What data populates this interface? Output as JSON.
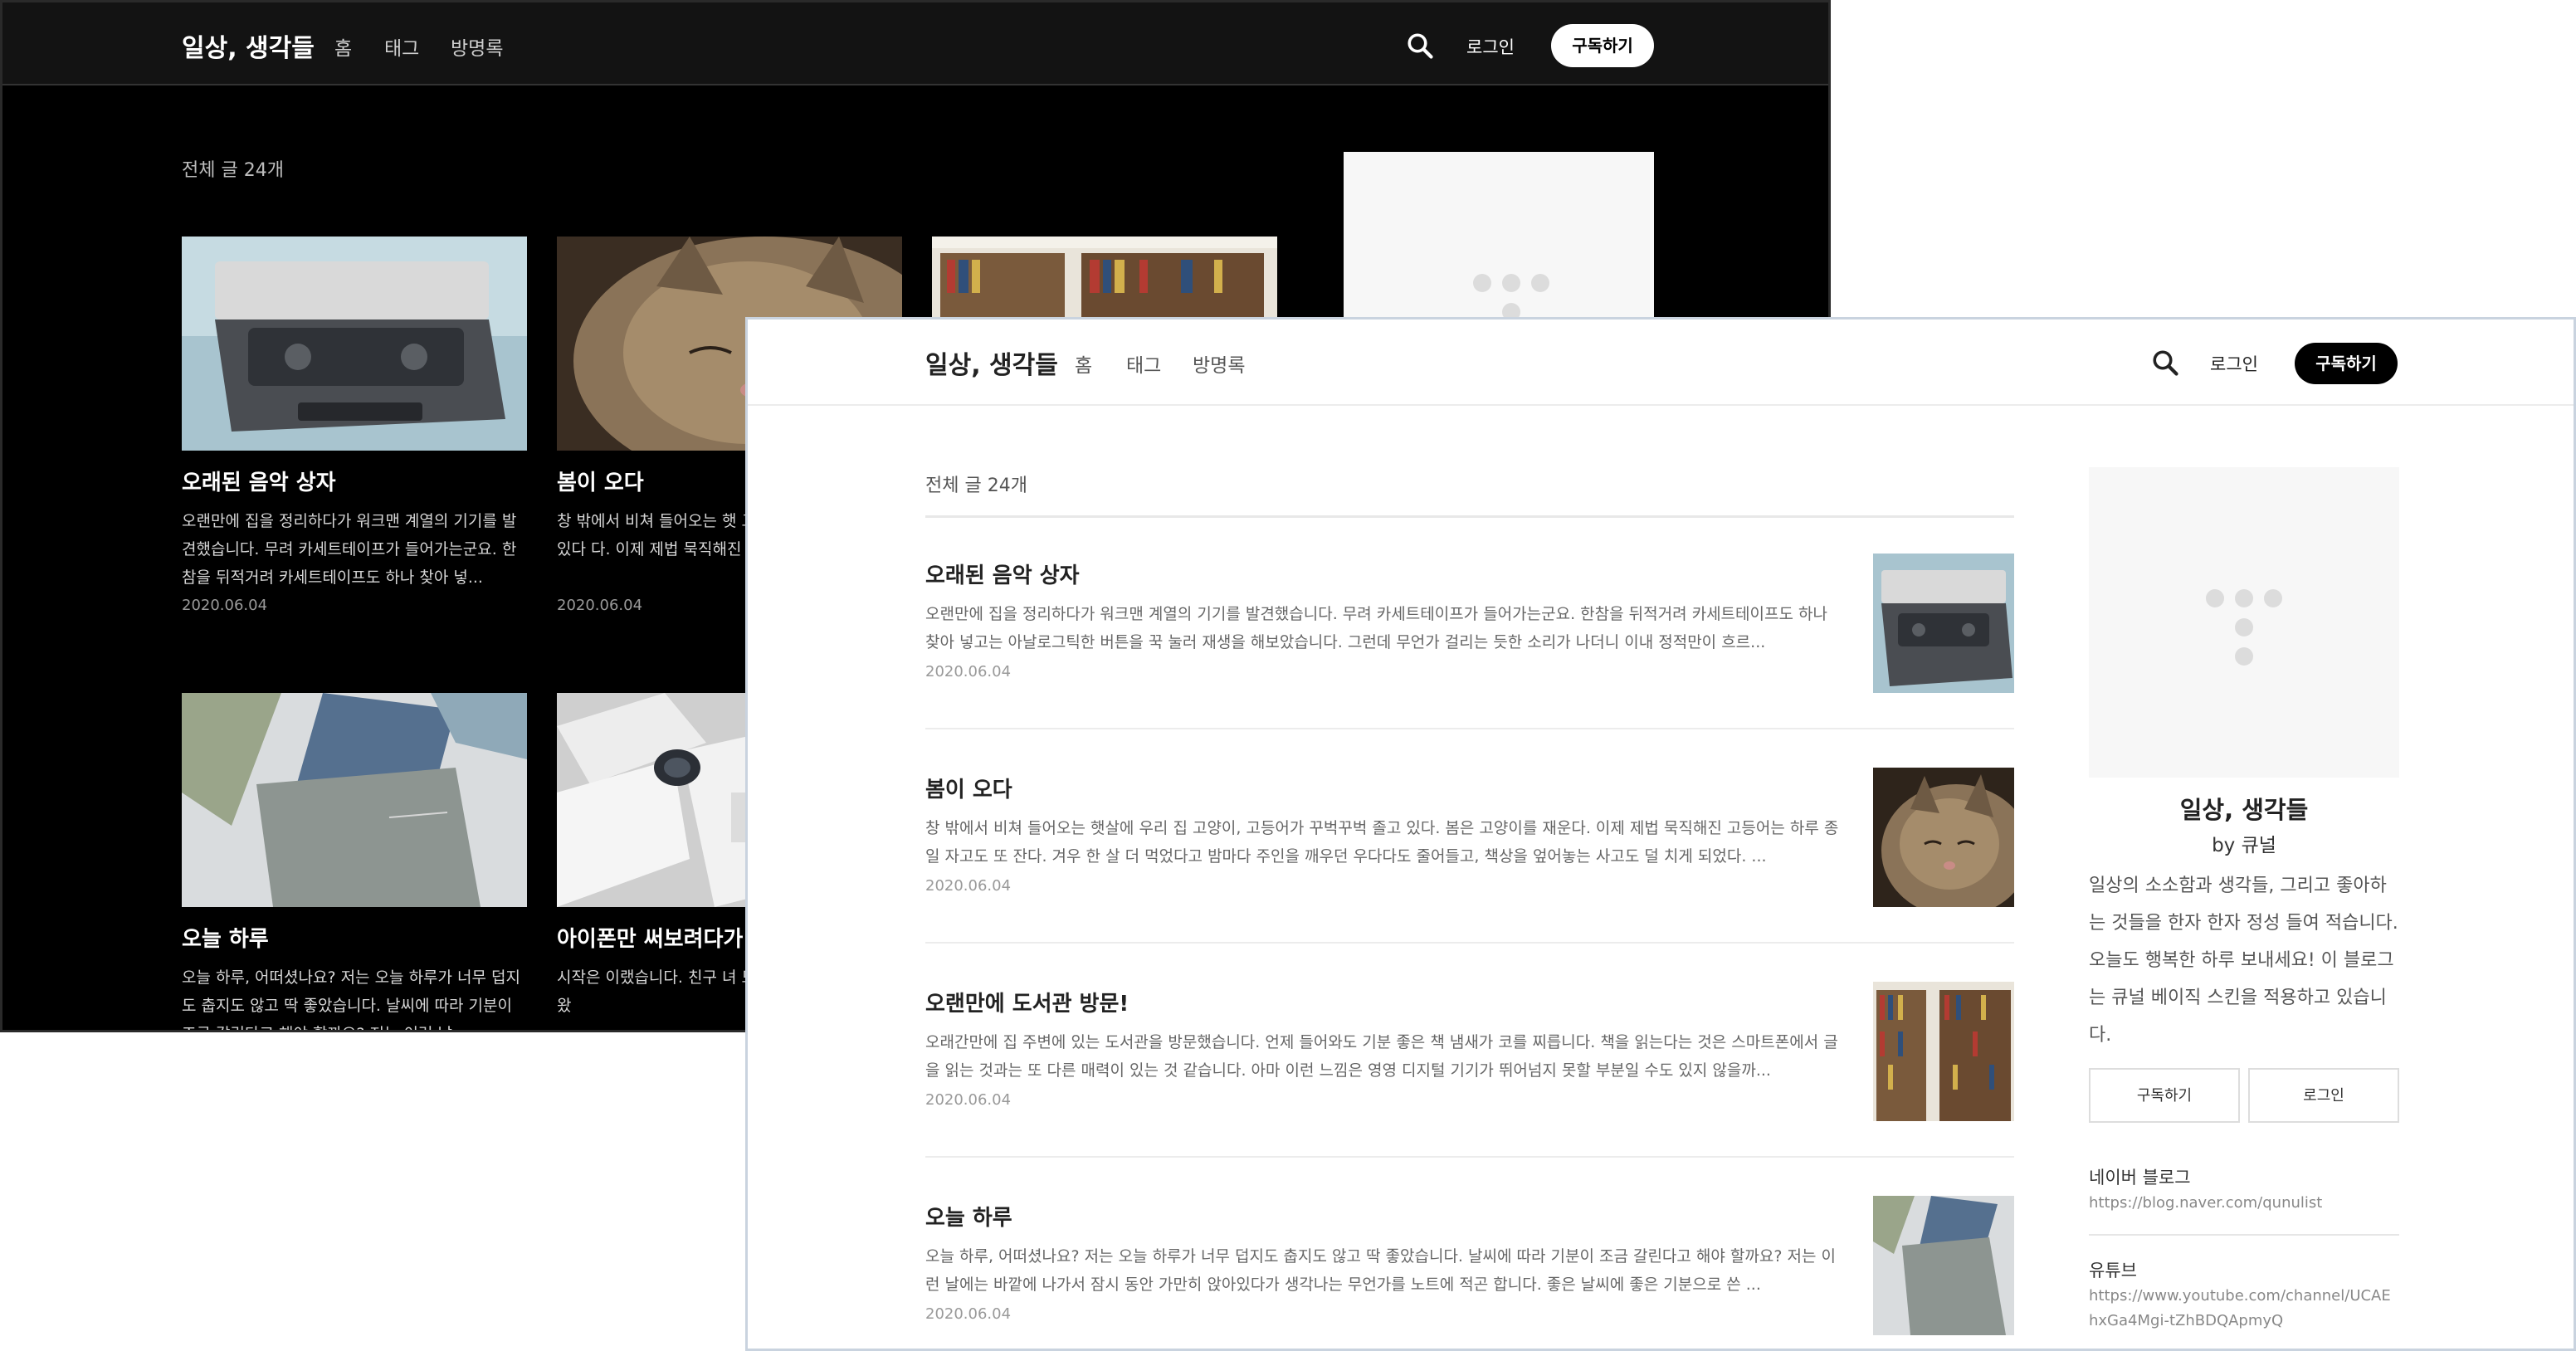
{
  "blog": {
    "title": "일상, 생각들",
    "nav": [
      "홈",
      "태그",
      "방명록"
    ],
    "login_label": "로그인",
    "subscribe_label": "구독하기",
    "post_count_label": "전체 글 24개"
  },
  "dark_view": {
    "cards": [
      {
        "title": "오래된 음악 상자",
        "excerpt": "오랜만에 집을 정리하다가 워크맨 계열의 기기를 발견했습니다. 무려 카세트테이프가 들어가는군요. 한참을 뒤적거려 카세트테이프도 하나 찾아 넣...",
        "date": "2020.06.04",
        "image": "cassette-player"
      },
      {
        "title": "봄이 오다",
        "excerpt": "창 밖에서 비쳐 들어오는 햇 고등어가 꾸벅꾸벅 졸고 있다 다. 이제 제법 묵직해진 고등",
        "date": "2020.06.04",
        "image": "sleeping-cat"
      },
      {
        "title": "오랜만에 도서관 방문!",
        "excerpt": "",
        "date": "",
        "image": "library-shelves"
      },
      {
        "title": "오늘 하루",
        "excerpt": "오늘 하루, 어떠셨나요? 저는 오늘 하루가 너무 덥지도 춥지도 않고 딱 좋았습니다. 날씨에 따라 기분이 조금 갈린다고 해야 할까요? 저는 이런 날...",
        "date": "",
        "image": "notebooks"
      },
      {
        "title": "아이폰만 써보려다가 된 썰",
        "excerpt": "시작은 이랬습니다. 친구 녀 모한 호대폰 하나를 가져왔",
        "date": "",
        "image": "watch-box"
      }
    ]
  },
  "light_view": {
    "posts": [
      {
        "title": "오래된 음악 상자",
        "excerpt": "오랜만에 집을 정리하다가 워크맨 계열의 기기를 발견했습니다. 무려 카세트테이프가 들어가는군요. 한참을 뒤적거려 카세트테이프도 하나 찾아 넣고는 아날로그틱한 버튼을 꾹 눌러 재생을 해보았습니다. 그런데 무언가 걸리는 듯한 소리가 나더니 이내 정적만이 흐르...",
        "date": "2020.06.04",
        "image": "cassette-player"
      },
      {
        "title": "봄이 오다",
        "excerpt": "창 밖에서 비쳐 들어오는 햇살에 우리 집 고양이, 고등어가 꾸벅꾸벅 졸고 있다. 봄은 고양이를 재운다. 이제 제법 묵직해진 고등어는 하루 종일 자고도 또 잔다. 겨우 한 살 더 먹었다고 밤마다 주인을 깨우던 우다다도 줄어들고, 책상을 엎어놓는 사고도 덜 치게 되었다. ...",
        "date": "2020.06.04",
        "image": "sleeping-cat"
      },
      {
        "title": "오랜만에 도서관 방문!",
        "excerpt": "오래간만에 집 주변에 있는 도서관을 방문했습니다. 언제 들어와도 기분 좋은 책 냄새가 코를 찌릅니다. 책을 읽는다는 것은 스마트폰에서 글을 읽는 것과는 또 다른 매력이 있는 것 같습니다. 아마 이런 느낌은 영영 디지털 기기가 뛰어넘지 못할 부분일 수도 있지 않을까...",
        "date": "2020.06.04",
        "image": "library-shelves"
      },
      {
        "title": "오늘 하루",
        "excerpt": "오늘 하루, 어떠셨나요? 저는 오늘 하루가 너무 덥지도 춥지도 않고 딱 좋았습니다. 날씨에 따라 기분이 조금 갈린다고 해야 할까요? 저는 이런 날에는 바깥에 나가서 잠시 동안 가만히 앉아있다가 생각나는 무언가를 노트에 적곤 합니다. 좋은 날씨에 좋은 기분으로 쓴 ...",
        "date": "2020.06.04",
        "image": "notebooks"
      }
    ],
    "sidebar": {
      "blog_title": "일상, 생각들",
      "author": "by 큐널",
      "description": "일상의 소소함과 생각들, 그리고 좋아하는 것들을 한자 한자 정성 들여 적습니다. 오늘도 행복한 하루 보내세요! 이 블로그는 큐널 베이직 스킨을 적용하고 있습니다.",
      "subscribe_label": "구독하기",
      "login_label": "로그인",
      "links": [
        {
          "label": "네이버 블로그",
          "url": "https://blog.naver.com/qunulist"
        },
        {
          "label": "유튜브",
          "url": "https://www.youtube.com/channel/UCAEhxGa4Mgi-tZhBDQApmyQ"
        }
      ]
    }
  },
  "colors": {
    "dark_bg": "#000000",
    "dark_header": "#131313",
    "light_bg": "#ffffff",
    "accent_button_dark": "#ffffff",
    "accent_button_light": "#000000",
    "window_border": "#c9d3df"
  },
  "icons": [
    "search-icon",
    "loading-dots-icon"
  ]
}
